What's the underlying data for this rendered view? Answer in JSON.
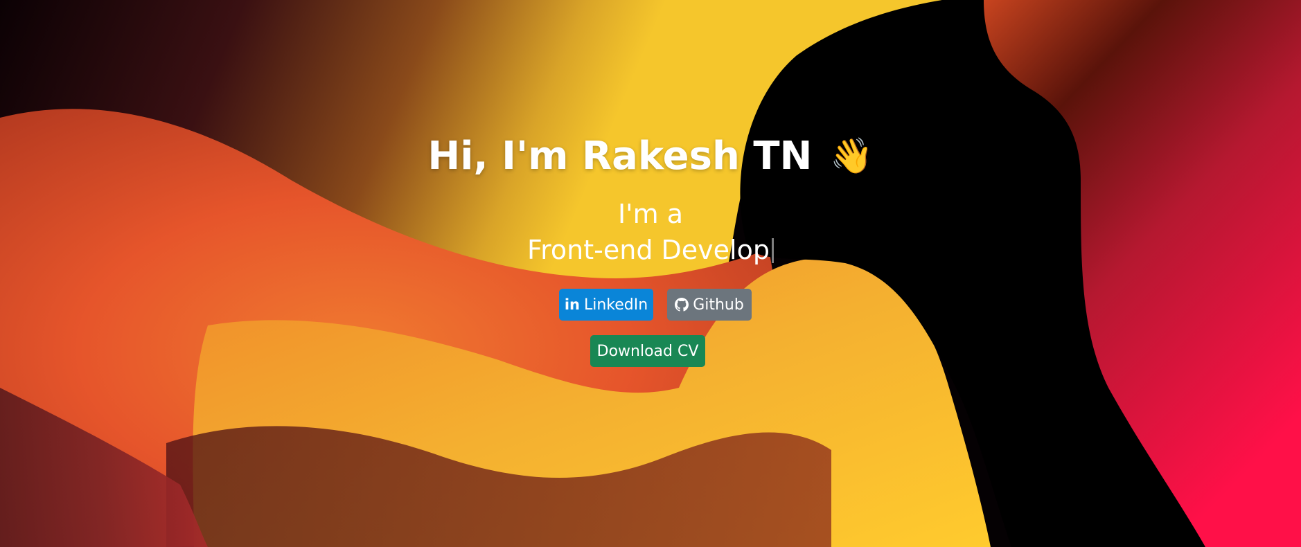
{
  "hero": {
    "greeting": "Hi, I'm Rakesh TN",
    "wave_emoji": "👋",
    "intro": "I'm a",
    "role_typed": "Front-end Develop"
  },
  "buttons": {
    "linkedin": {
      "label": "LinkedIn",
      "icon": "linkedin-icon",
      "icon_text": "in",
      "color": "#0a85d8"
    },
    "github": {
      "label": "Github",
      "icon": "github-icon",
      "color": "#6c757d"
    },
    "download_cv": {
      "label": "Download CV",
      "color": "#198754"
    }
  },
  "colors": {
    "background_dark": "#000000",
    "orange": "#f0712a",
    "yellow": "#f4c430",
    "pink_red": "#f0124a"
  }
}
